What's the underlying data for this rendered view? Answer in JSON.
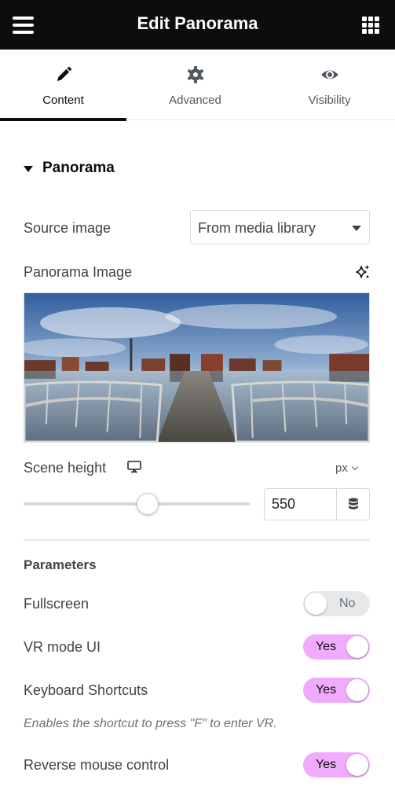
{
  "header": {
    "title": "Edit Panorama",
    "menu_icon": "hamburger-menu-icon",
    "apps_icon": "grid-apps-icon"
  },
  "tabs": [
    {
      "label": "Content",
      "icon": "pencil-icon",
      "active": true
    },
    {
      "label": "Advanced",
      "icon": "gear-icon",
      "active": false
    },
    {
      "label": "Visibility",
      "icon": "eye-icon",
      "active": false
    }
  ],
  "section": {
    "title": "Panorama",
    "source_image": {
      "label": "Source image",
      "value": "From media library"
    },
    "panorama_image": {
      "label": "Panorama Image",
      "ai_icon": "sparkle-ai-icon"
    },
    "scene_height": {
      "label": "Scene height",
      "device_icon": "desktop-monitor-icon",
      "unit": "px",
      "value": "550",
      "dynamic_icon": "database-icon"
    },
    "parameters": {
      "title": "Parameters",
      "fullscreen": {
        "label": "Fullscreen",
        "state": "No"
      },
      "vr_mode_ui": {
        "label": "VR mode UI",
        "state": "Yes"
      },
      "keyboard_shortcuts": {
        "label": "Keyboard Shortcuts",
        "state": "Yes",
        "description": "Enables the shortcut to press \"F\" to enter VR."
      },
      "reverse_mouse": {
        "label": "Reverse mouse control",
        "state": "Yes"
      }
    }
  },
  "colors": {
    "header_bg": "#0c0d0e",
    "toggle_on": "#f0abfc",
    "toggle_off": "#e6e8ea"
  }
}
